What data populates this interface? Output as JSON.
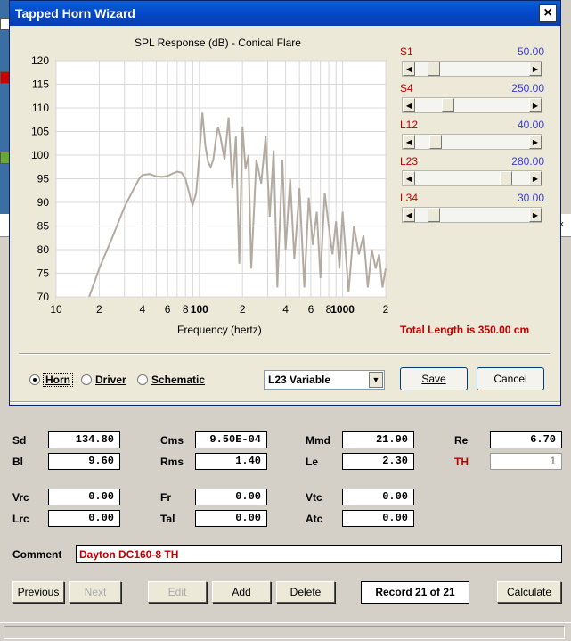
{
  "dialog": {
    "title": "Tapped Horn Wizard",
    "close_label": "×"
  },
  "chart_data": {
    "type": "line",
    "title": "SPL Response (dB) - Conical Flare",
    "xlabel": "Frequency (hertz)",
    "ylabel": "",
    "x_scale": "log",
    "xlim": [
      10,
      200
    ],
    "ylim": [
      70,
      120
    ],
    "x_tick_labels": [
      "10",
      "2",
      "4",
      "6",
      "8",
      "100",
      "2",
      "4",
      "6",
      "8",
      "1000",
      "2"
    ],
    "x_tick_values": [
      10,
      20,
      40,
      60,
      80,
      100,
      200,
      400,
      600,
      800,
      1000,
      2000
    ],
    "y_tick_labels": [
      "120",
      "115",
      "110",
      "105",
      "100",
      "95",
      "90",
      "85",
      "80",
      "75",
      "70"
    ],
    "y_tick_values": [
      120,
      115,
      110,
      105,
      100,
      95,
      90,
      85,
      80,
      75,
      70
    ],
    "grid": true,
    "line_color": "#b3aba1",
    "series": [
      {
        "x": [
          17,
          20,
          25,
          30,
          35,
          38,
          40,
          45,
          50,
          55,
          60,
          65,
          70,
          75,
          80,
          85,
          88,
          90,
          95,
          100,
          105,
          110,
          115,
          120,
          125,
          130,
          135,
          140,
          150,
          160,
          170,
          180,
          190,
          200,
          210,
          220,
          230,
          250,
          270,
          290,
          310,
          330,
          350,
          380,
          400,
          430,
          460,
          500,
          540,
          580,
          620,
          660,
          700,
          750,
          800,
          850,
          900,
          950,
          1000,
          1100,
          1200,
          1300,
          1400,
          1500,
          1600,
          1700,
          1800,
          1900,
          2000
        ],
        "y": [
          70,
          76,
          83,
          89,
          93,
          95,
          95.8,
          96,
          95.5,
          95.4,
          95.6,
          96.1,
          96.5,
          96.3,
          95,
          92,
          90,
          89.5,
          92,
          100,
          109,
          102,
          98.5,
          97.5,
          99,
          103,
          106,
          104,
          99,
          108,
          93,
          104,
          77,
          106,
          97,
          100,
          76,
          99,
          94,
          104,
          87,
          101,
          72,
          99,
          80,
          95,
          78,
          93,
          72,
          91,
          81,
          88,
          74,
          92,
          85,
          79,
          86,
          76,
          88,
          71,
          85,
          79,
          83,
          72,
          80,
          76,
          79,
          72,
          76
        ]
      }
    ]
  },
  "sliders": [
    {
      "name": "S1",
      "value": "50.00",
      "fraction": 0.12
    },
    {
      "name": "S4",
      "value": "250.00",
      "fraction": 0.26
    },
    {
      "name": "L12",
      "value": "40.00",
      "fraction": 0.14
    },
    {
      "name": "L23",
      "value": "280.00",
      "fraction": 0.83
    },
    {
      "name": "L34",
      "value": "30.00",
      "fraction": 0.12
    }
  ],
  "slider_left_arrow": "◀",
  "slider_right_arrow": "▶",
  "total_length": "Total Length is 350.00 cm",
  "view_options": {
    "horn": "Horn",
    "driver": "Driver",
    "schematic": "Schematic",
    "selected": "Horn"
  },
  "mode_select": {
    "value": "L23 Variable",
    "arrow": "▼"
  },
  "dialog_buttons": {
    "save": "Save",
    "cancel": "Cancel"
  },
  "params": {
    "sd": {
      "label": "Sd",
      "value": "134.80"
    },
    "bl": {
      "label": "Bl",
      "value": "9.60"
    },
    "cms": {
      "label": "Cms",
      "value": "9.50E-04"
    },
    "rms": {
      "label": "Rms",
      "value": "1.40"
    },
    "mmd": {
      "label": "Mmd",
      "value": "21.90"
    },
    "le": {
      "label": "Le",
      "value": "2.30"
    },
    "re": {
      "label": "Re",
      "value": "6.70"
    },
    "th": {
      "label": "TH",
      "value": "1"
    },
    "vrc": {
      "label": "Vrc",
      "value": "0.00"
    },
    "lrc": {
      "label": "Lrc",
      "value": "0.00"
    },
    "fr": {
      "label": "Fr",
      "value": "0.00"
    },
    "tal": {
      "label": "Tal",
      "value": "0.00"
    },
    "vtc": {
      "label": "Vtc",
      "value": "0.00"
    },
    "atc": {
      "label": "Atc",
      "value": "0.00"
    }
  },
  "comment": {
    "label": "Comment",
    "value": "Dayton DC160-8 TH"
  },
  "record_nav": {
    "previous": "Previous",
    "next": "Next",
    "edit": "Edit",
    "add": "Add",
    "delete": "Delete",
    "record": "Record 21 of 21",
    "calculate": "Calculate"
  },
  "background_close": "×"
}
